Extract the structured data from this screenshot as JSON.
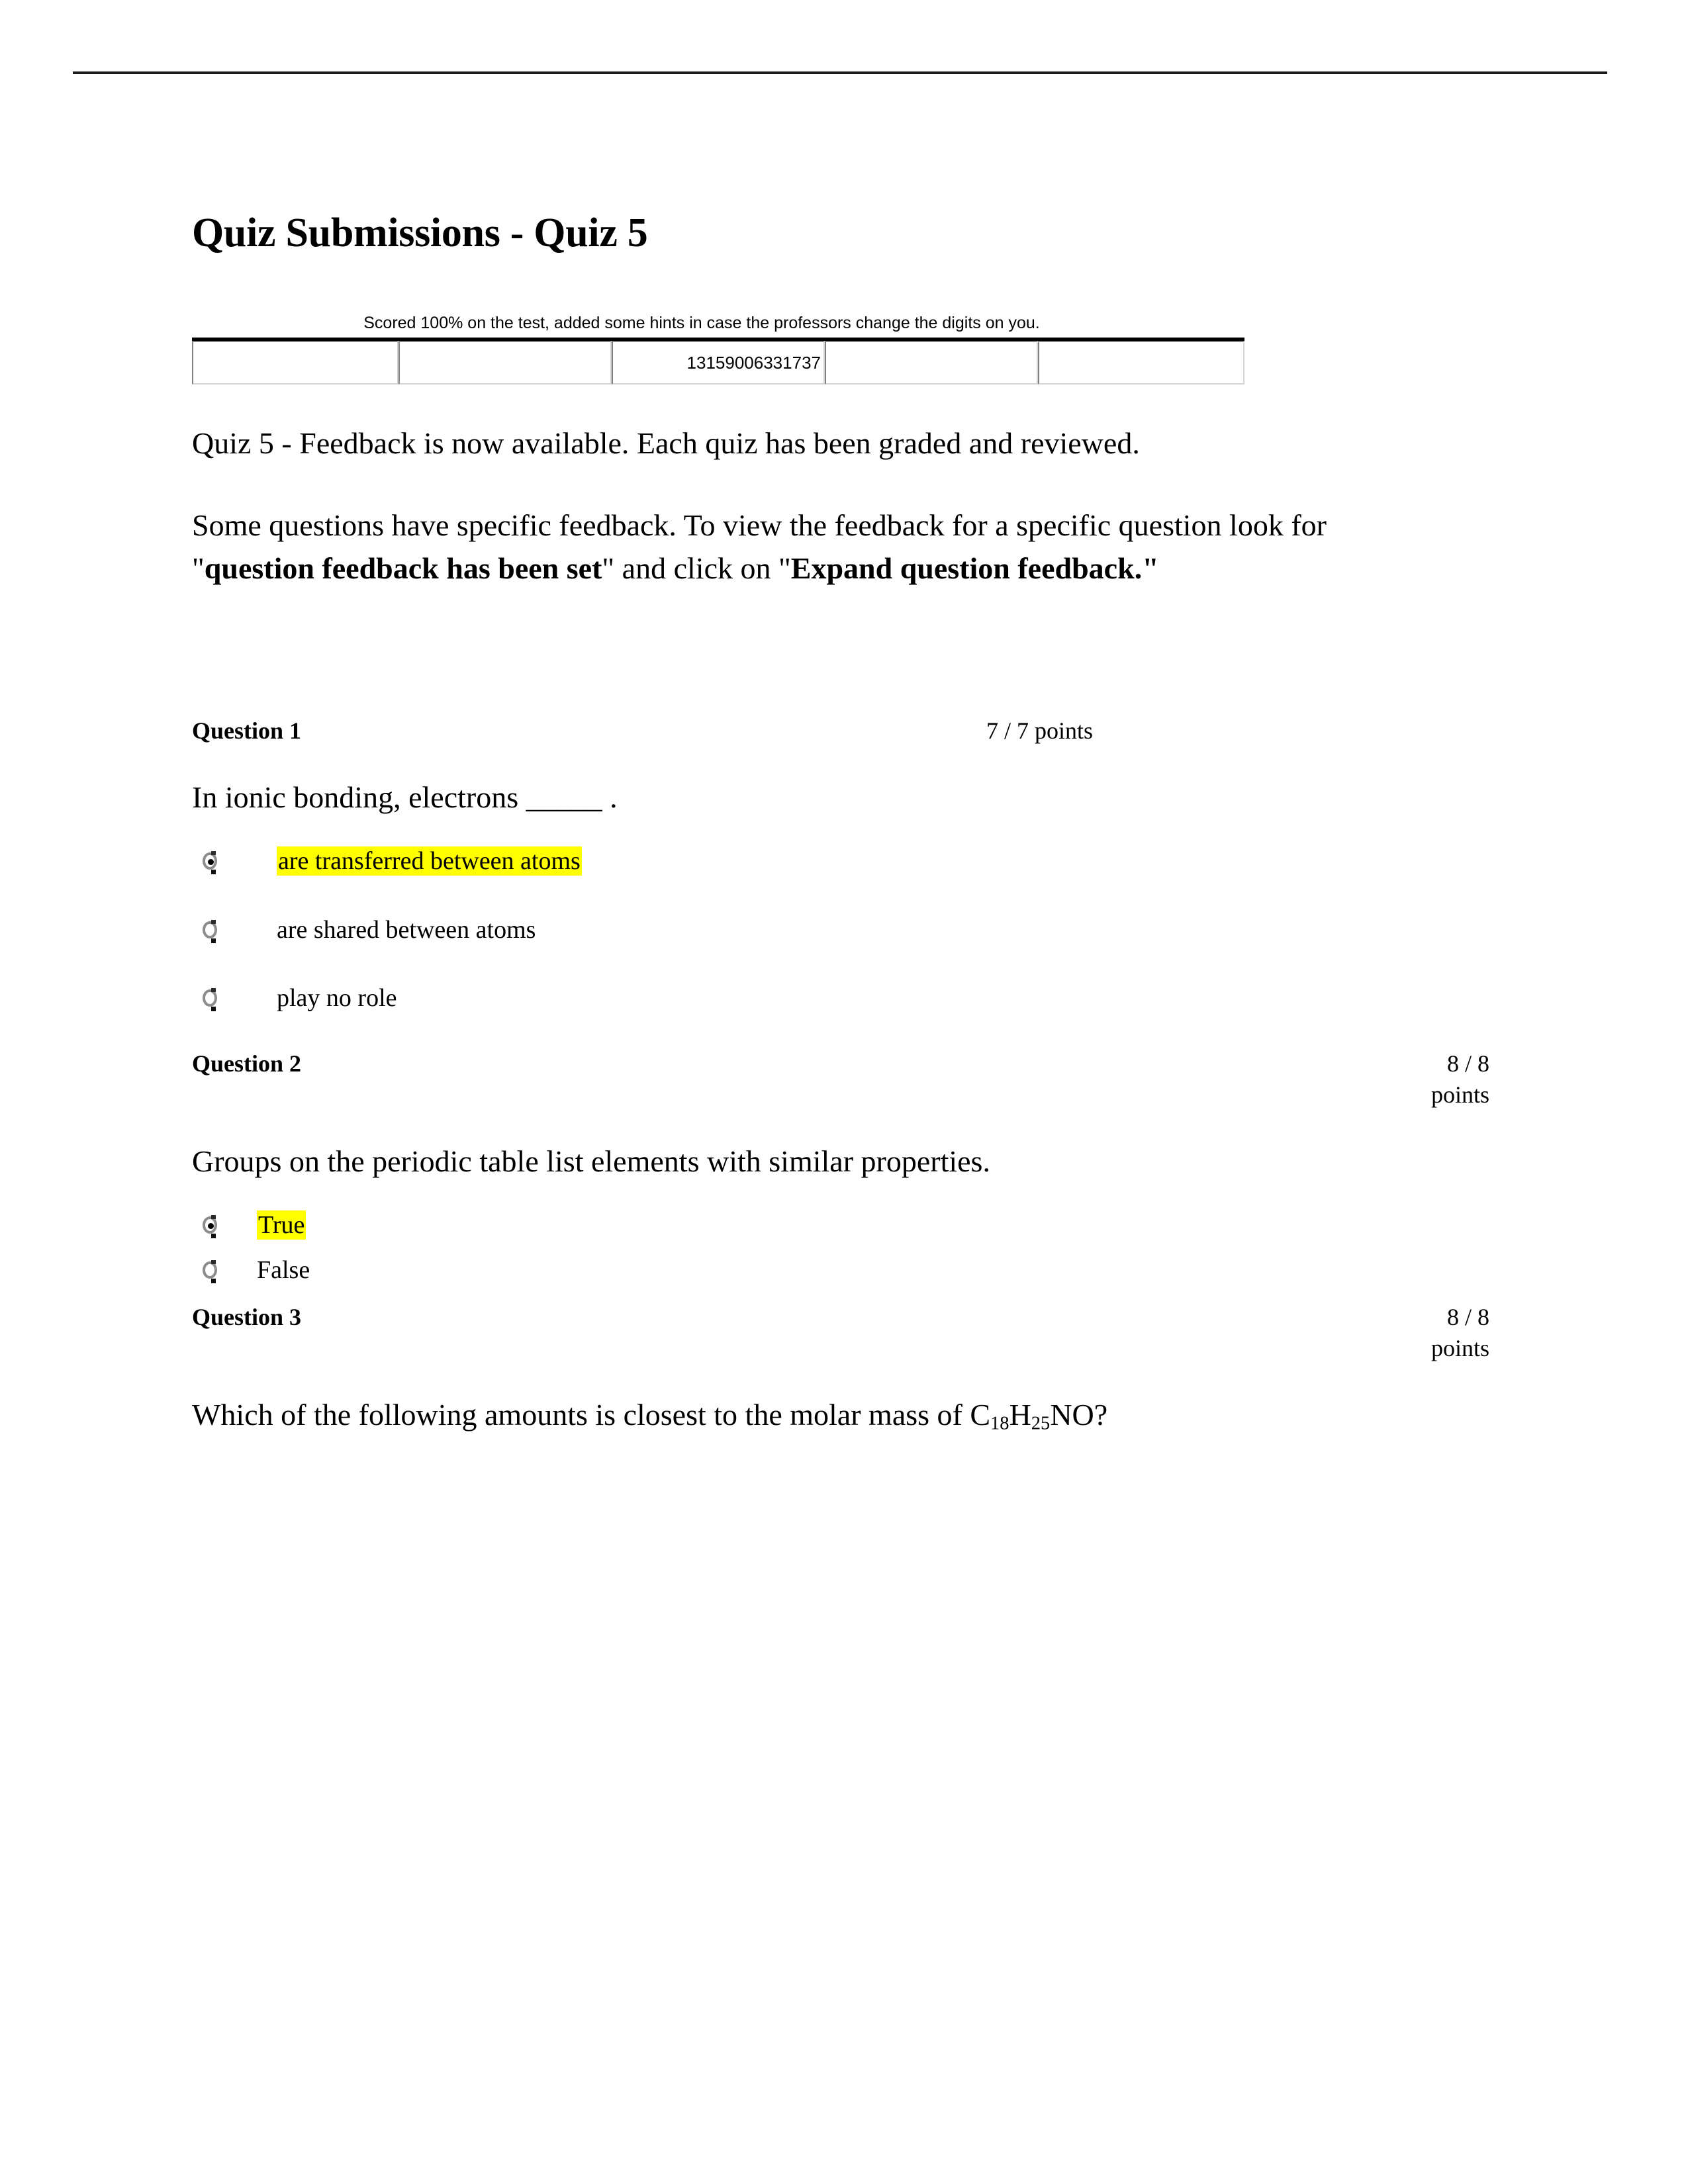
{
  "document": {
    "title": "Quiz Submissions - Quiz 5"
  },
  "hint_note": {
    "text": "Scored 100% on the test, added some hints in case the professors change the digits on you.",
    "table": {
      "cells": [
        "",
        "",
        "13159006331737",
        "",
        ""
      ]
    }
  },
  "intro": {
    "paragraph1": "Quiz 5 - Feedback is now available. Each quiz has been graded and reviewed.",
    "p2_part1": "Some questions have specific feedback. To view the feedback for a specific question look for \"",
    "p2_bold1": "question feedback has been set",
    "p2_part2": "\" and click on \"",
    "p2_bold2": "Expand question feedback",
    "p2_part3": ".\""
  },
  "questions": [
    {
      "label": "Question 1",
      "points": "7 / 7 points",
      "text": "In ionic bonding, electrons _____ .",
      "options": [
        {
          "label": "are transferred between atoms",
          "selected": true,
          "highlighted": true
        },
        {
          "label": "are shared between atoms",
          "selected": false,
          "highlighted": false
        },
        {
          "label": "play no role",
          "selected": false,
          "highlighted": false
        }
      ]
    },
    {
      "label": "Question 2",
      "points": "8 / 8 points",
      "text": "Groups on the periodic table list elements with similar properties.",
      "options": [
        {
          "label": "True",
          "selected": true,
          "highlighted": true
        },
        {
          "label": "False",
          "selected": false,
          "highlighted": false
        }
      ]
    },
    {
      "label": "Question 3",
      "points": "8 / 8 points",
      "text_prefix": "Which of the following amounts is closest to the molar mass of C",
      "sub1": "18",
      "text_mid1": "H",
      "sub2": "25",
      "text_suffix": "NO?"
    }
  ],
  "colors": {
    "highlight": "#ffff00",
    "text": "#000000",
    "rule": "#1a1a1a",
    "table_border_dark": "#808080",
    "table_border_light": "#d4d4d4"
  }
}
